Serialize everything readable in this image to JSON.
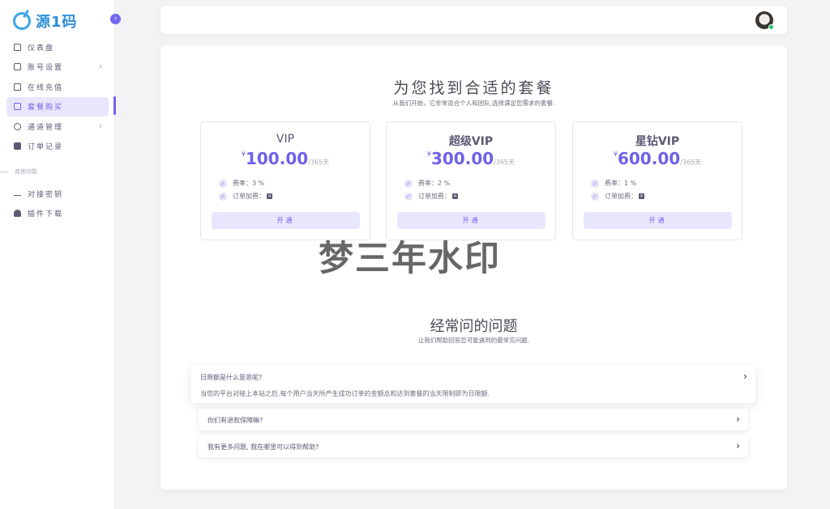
{
  "brand": {
    "name": "源1码"
  },
  "sidebar": {
    "items": [
      {
        "label": "仪表盘",
        "icon": "home-icon",
        "has_arrow": false
      },
      {
        "label": "账号设置",
        "icon": "user-icon",
        "has_arrow": true
      },
      {
        "label": "在线充值",
        "icon": "money-icon",
        "has_arrow": false
      },
      {
        "label": "套餐购买",
        "icon": "shopping-bag-icon",
        "has_arrow": false,
        "active": true
      },
      {
        "label": "通道管理",
        "icon": "gear-icon",
        "has_arrow": true
      },
      {
        "label": "订单记录",
        "icon": "wallet-icon",
        "has_arrow": false
      }
    ],
    "section_label": "其他功能",
    "items2": [
      {
        "label": "对接密钥",
        "icon": "key-icon"
      },
      {
        "label": "插件下载",
        "icon": "cloud-download-icon"
      }
    ]
  },
  "pricing": {
    "title": "为您找到合适的套餐",
    "subtitle": "从我们开始，它非常适合个人和团队,选择满足您需求的套餐.",
    "plans": [
      {
        "name": "VIP",
        "currency": "¥",
        "price": "100.00",
        "period": "/365天",
        "fee": "费率：3 %",
        "surcharge": "订单加费：",
        "button": "开通"
      },
      {
        "name": "超级VIP",
        "currency": "¥",
        "price": "300.00",
        "period": "/365天",
        "fee": "费率：2 %",
        "surcharge": "订单加费：",
        "button": "开通"
      },
      {
        "name": "星钻VIP",
        "currency": "¥",
        "price": "600.00",
        "period": "/365天",
        "fee": "费率：1 %",
        "surcharge": "订单加费：",
        "button": "开通"
      }
    ]
  },
  "watermark": "梦三年水印",
  "faq": {
    "title": "经常问的问题",
    "subtitle": "让我们帮助回答您可能遇到的最常见问题.",
    "items": [
      {
        "question": "日限额是什么意思呢?",
        "answer": "当您的平台对接上本站之后,每个用户当天所产生成功订单的金额总和达到套餐的当天限制即为日限额."
      },
      {
        "question": "你们有退款保障嘛?"
      },
      {
        "question": "我有更多问题, 我在哪里可以得到帮助?"
      }
    ]
  },
  "colors": {
    "accent": "#7367f0",
    "accent_light": "#e8e6fd",
    "online": "#28c76f"
  }
}
